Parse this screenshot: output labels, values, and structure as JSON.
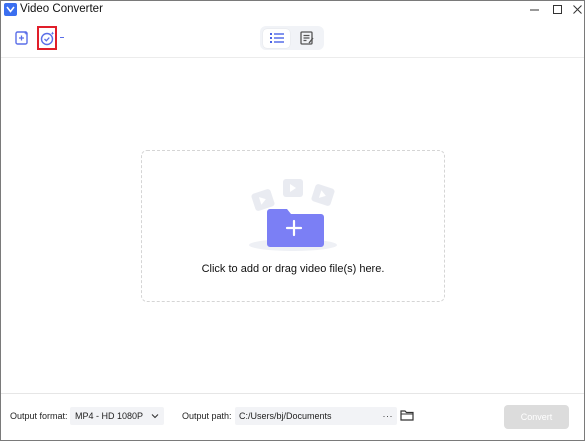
{
  "window": {
    "title": "Video Converter",
    "minimize_glyph": "—",
    "maximize_glyph": "☐",
    "close_glyph": "✕"
  },
  "toolbar": {
    "icons": {
      "add_file": "add-file-icon",
      "enhance": "ai-enhance-icon",
      "list_view": "list-view-icon",
      "task_view": "task-list-icon"
    },
    "highlight_color": "#e01e2a",
    "accent_color": "#5a6ee8"
  },
  "dropzone": {
    "text": "Click to add or drag video file(s) here.",
    "folder_color": "#7b7ff5",
    "plus_glyph": "+"
  },
  "footer": {
    "output_format_label": "Output format:",
    "output_format_value": "MP4 - HD 1080P",
    "output_path_label": "Output path:",
    "output_path_value": "C:/Users/bj/Documents",
    "path_more": "···",
    "convert_label": "Convert",
    "convert_color": "#dcdcdc"
  }
}
